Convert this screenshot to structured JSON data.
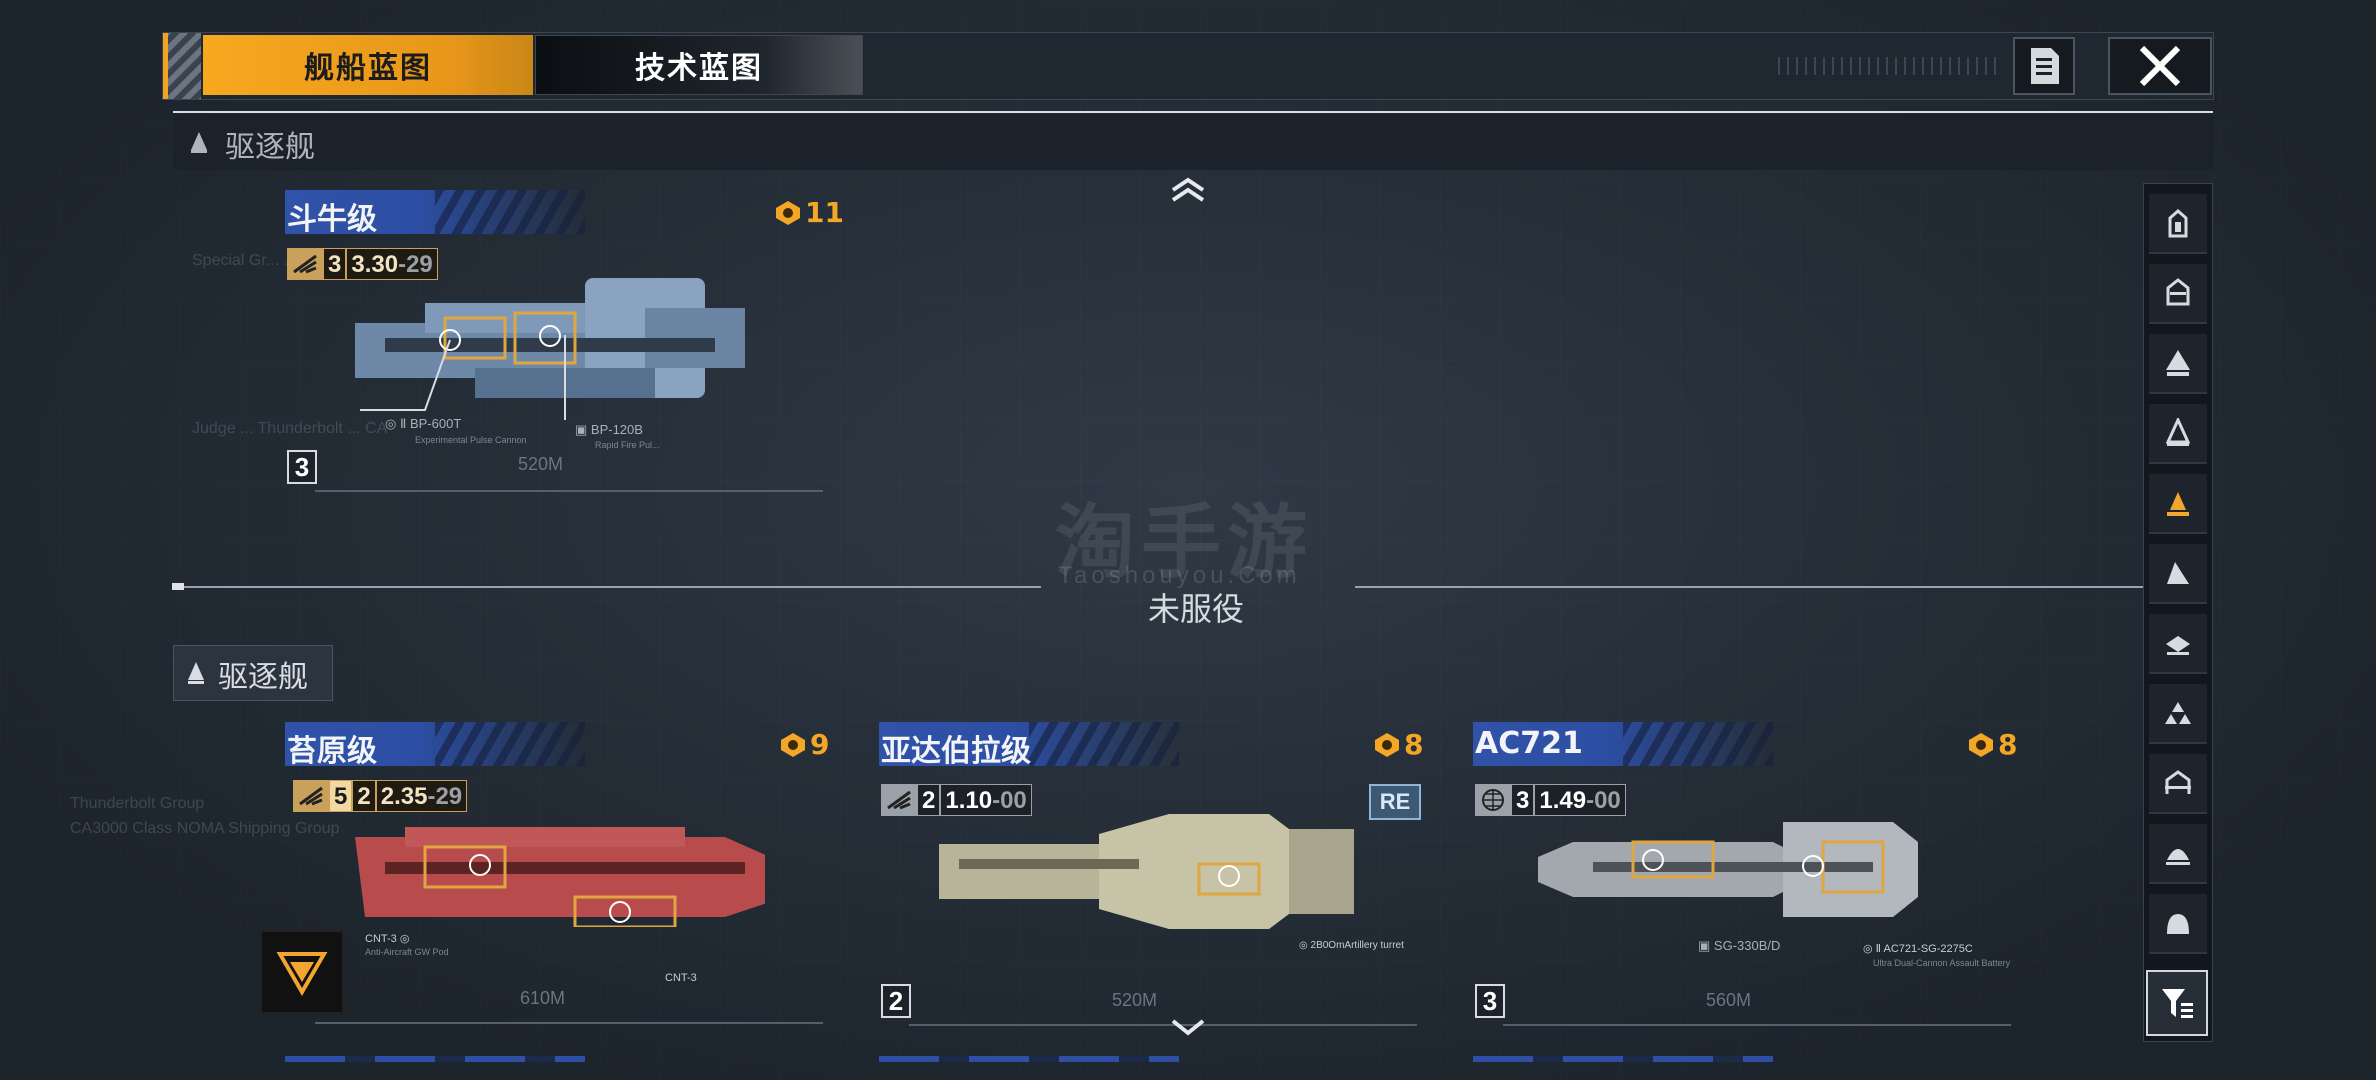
{
  "tabs": {
    "ship_blueprint": "舰船蓝图",
    "tech_blueprint": "技术蓝图"
  },
  "icons": {
    "doc": "document-icon",
    "close": "close-icon",
    "filter": "funnel-icon"
  },
  "colors": {
    "accent": "#f6a91f",
    "name_bar": "#2f50a6",
    "background": "#242d37"
  },
  "top_section": {
    "label": "驱逐舰",
    "ship": {
      "name": "斗牛级",
      "cost": "11",
      "stat": {
        "level": "3",
        "main": "3.30",
        "sub": "29"
      },
      "tier": "3",
      "length": "520M",
      "weapons": [
        {
          "code": "BP-600T",
          "desc": "Experimental Pulse Cannon"
        },
        {
          "code": "BP-120B",
          "desc": "Rapid Fire Pul..."
        }
      ]
    }
  },
  "divider_label": "未服役",
  "watermark": {
    "main": "淘手游",
    "sub": "Taoshouyou.Com"
  },
  "bottom_section": {
    "label": "驱逐舰",
    "ships": [
      {
        "name": "苔原级",
        "cost": "9",
        "stat": {
          "extra": "5",
          "level": "2",
          "main": "2.35",
          "sub": "29"
        },
        "length": "610M",
        "weapons": [
          {
            "code": "CNT-3",
            "desc": "Anti-Aircraft GW Pod"
          },
          {
            "code": "CNT-3",
            "desc": ""
          }
        ]
      },
      {
        "name": "亚达伯拉级",
        "cost": "8",
        "stat": {
          "level": "2",
          "main": "1.10",
          "sub": "00"
        },
        "tier": "2",
        "length": "520M",
        "badge": "RE",
        "weapons": [
          {
            "code": "2B0OmArtillery turret",
            "desc": ""
          }
        ]
      },
      {
        "name": "AC721",
        "cost": "8",
        "stat": {
          "level": "3",
          "main": "1.49",
          "sub": "00"
        },
        "tier": "3",
        "length": "560M",
        "weapons": [
          {
            "code": "SG-330B/D",
            "desc": ""
          },
          {
            "code": "AC721-SG-2275C",
            "desc": "Ultra Dual-Cannon Assault Battery"
          }
        ]
      }
    ]
  }
}
